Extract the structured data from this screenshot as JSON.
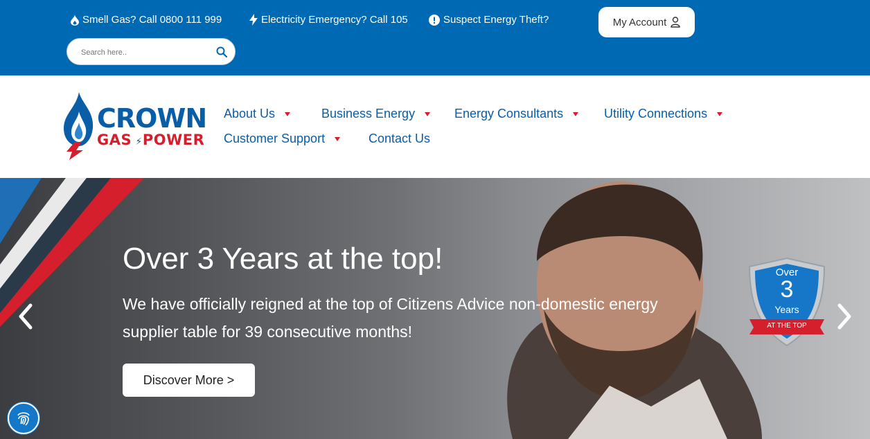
{
  "topbar": {
    "gas": "Smell Gas? Call 0800 111 999",
    "electricity": "Electricity Emergency? Call 105",
    "theft": "Suspect Energy Theft?",
    "account": "My Account",
    "search_placeholder": "Search here.."
  },
  "logo": {
    "line1": "CROWN",
    "line2": "GAS",
    "line3": "POWER"
  },
  "nav": {
    "about": "About Us",
    "business": "Business Energy",
    "consultants": "Energy Consultants",
    "utility": "Utility Connections",
    "support": "Customer Support",
    "contact": "Contact Us"
  },
  "hero": {
    "title": "Over 3 Years at the top!",
    "subtitle": "We have officially reigned at the top of Citizens Advice non-domestic energy supplier table for 39 consecutive months!",
    "button": "Discover More >",
    "badge_over": "Over",
    "badge_number": "3",
    "badge_years": "Years",
    "badge_ribbon": "AT THE TOP"
  },
  "colors": {
    "brand_blue": "#0069b4",
    "brand_red": "#d61f2c",
    "nav_blue": "#0a5ea8"
  }
}
